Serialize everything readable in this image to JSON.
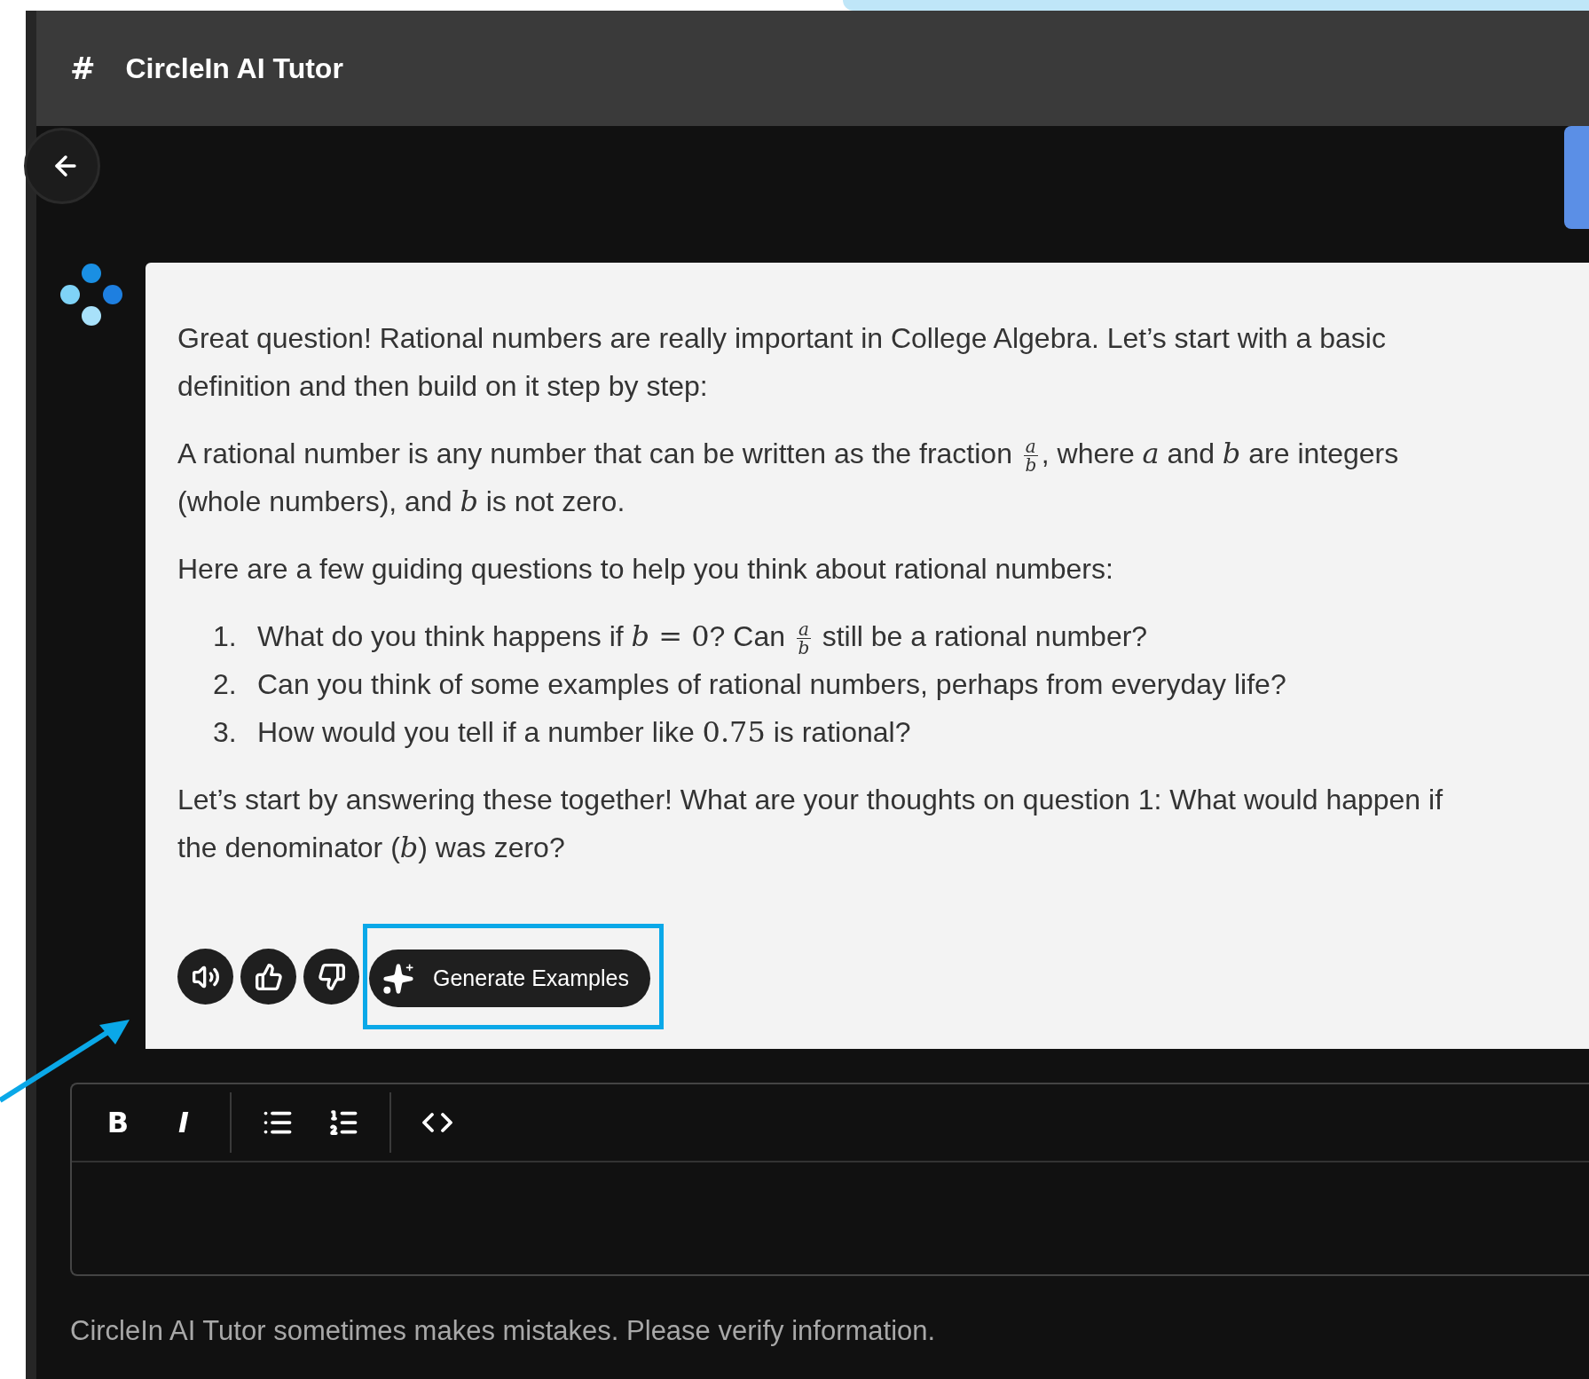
{
  "header": {
    "symbol": "#",
    "title": "CircleIn AI Tutor"
  },
  "message": {
    "blocks": [
      {
        "kind": "paragraph",
        "segments": [
          {
            "kind": "text",
            "text": "Great question! Rational numbers are really important in College Algebra. Let’s start with a basic definition and then build on it step by step:"
          }
        ]
      },
      {
        "kind": "paragraph",
        "segments": [
          {
            "kind": "text",
            "text": "A rational number is any number that can be written as the fraction "
          },
          {
            "kind": "frac",
            "num": "a",
            "den": "b"
          },
          {
            "kind": "text",
            "text": ", where "
          },
          {
            "kind": "math",
            "text": "*a*"
          },
          {
            "kind": "text",
            "text": " and "
          },
          {
            "kind": "math",
            "text": "*b*"
          },
          {
            "kind": "text",
            "text": " are integers (whole numbers), and "
          },
          {
            "kind": "math",
            "text": "*b*"
          },
          {
            "kind": "text",
            "text": " is not zero."
          }
        ]
      },
      {
        "kind": "paragraph",
        "segments": [
          {
            "kind": "text",
            "text": "Here are a few guiding questions to help you think about rational numbers:"
          }
        ]
      },
      {
        "kind": "list",
        "items": [
          {
            "number": "1.",
            "segments": [
              {
                "kind": "text",
                "text": "What do you think happens if "
              },
              {
                "kind": "math",
                "text": "*b* = 0"
              },
              {
                "kind": "text",
                "text": "? Can "
              },
              {
                "kind": "frac",
                "num": "a",
                "den": "b"
              },
              {
                "kind": "text",
                "text": " still be a rational number?"
              }
            ]
          },
          {
            "number": "2.",
            "segments": [
              {
                "kind": "text",
                "text": "Can you think of some examples of rational numbers, perhaps from everyday life?"
              }
            ]
          },
          {
            "number": "3.",
            "segments": [
              {
                "kind": "text",
                "text": "How would you tell if a number like "
              },
              {
                "kind": "math",
                "text": "0.75"
              },
              {
                "kind": "text",
                "text": " is rational?"
              }
            ]
          }
        ]
      },
      {
        "kind": "paragraph",
        "segments": [
          {
            "kind": "text",
            "text": "Let’s start by answering these together! What are your thoughts on question 1: What would happen if the denominator ("
          },
          {
            "kind": "math",
            "text": "*b*"
          },
          {
            "kind": "text",
            "text": ") was zero?"
          }
        ]
      }
    ]
  },
  "actions": [
    {
      "kind": "speak"
    },
    {
      "kind": "like"
    },
    {
      "kind": "dislike"
    },
    {
      "kind": "generate",
      "label": "Generate Examples",
      "highlighted": true
    }
  ],
  "editor": {
    "tools": [
      {
        "kind": "bold",
        "text": "B"
      },
      {
        "kind": "italic",
        "text": "I"
      },
      {
        "kind": "divider"
      },
      {
        "kind": "bullets"
      },
      {
        "kind": "numbers"
      },
      {
        "kind": "divider"
      },
      {
        "kind": "code"
      }
    ]
  },
  "footer": "CircleIn AI Tutor sometimes makes mistakes. Please verify information."
}
